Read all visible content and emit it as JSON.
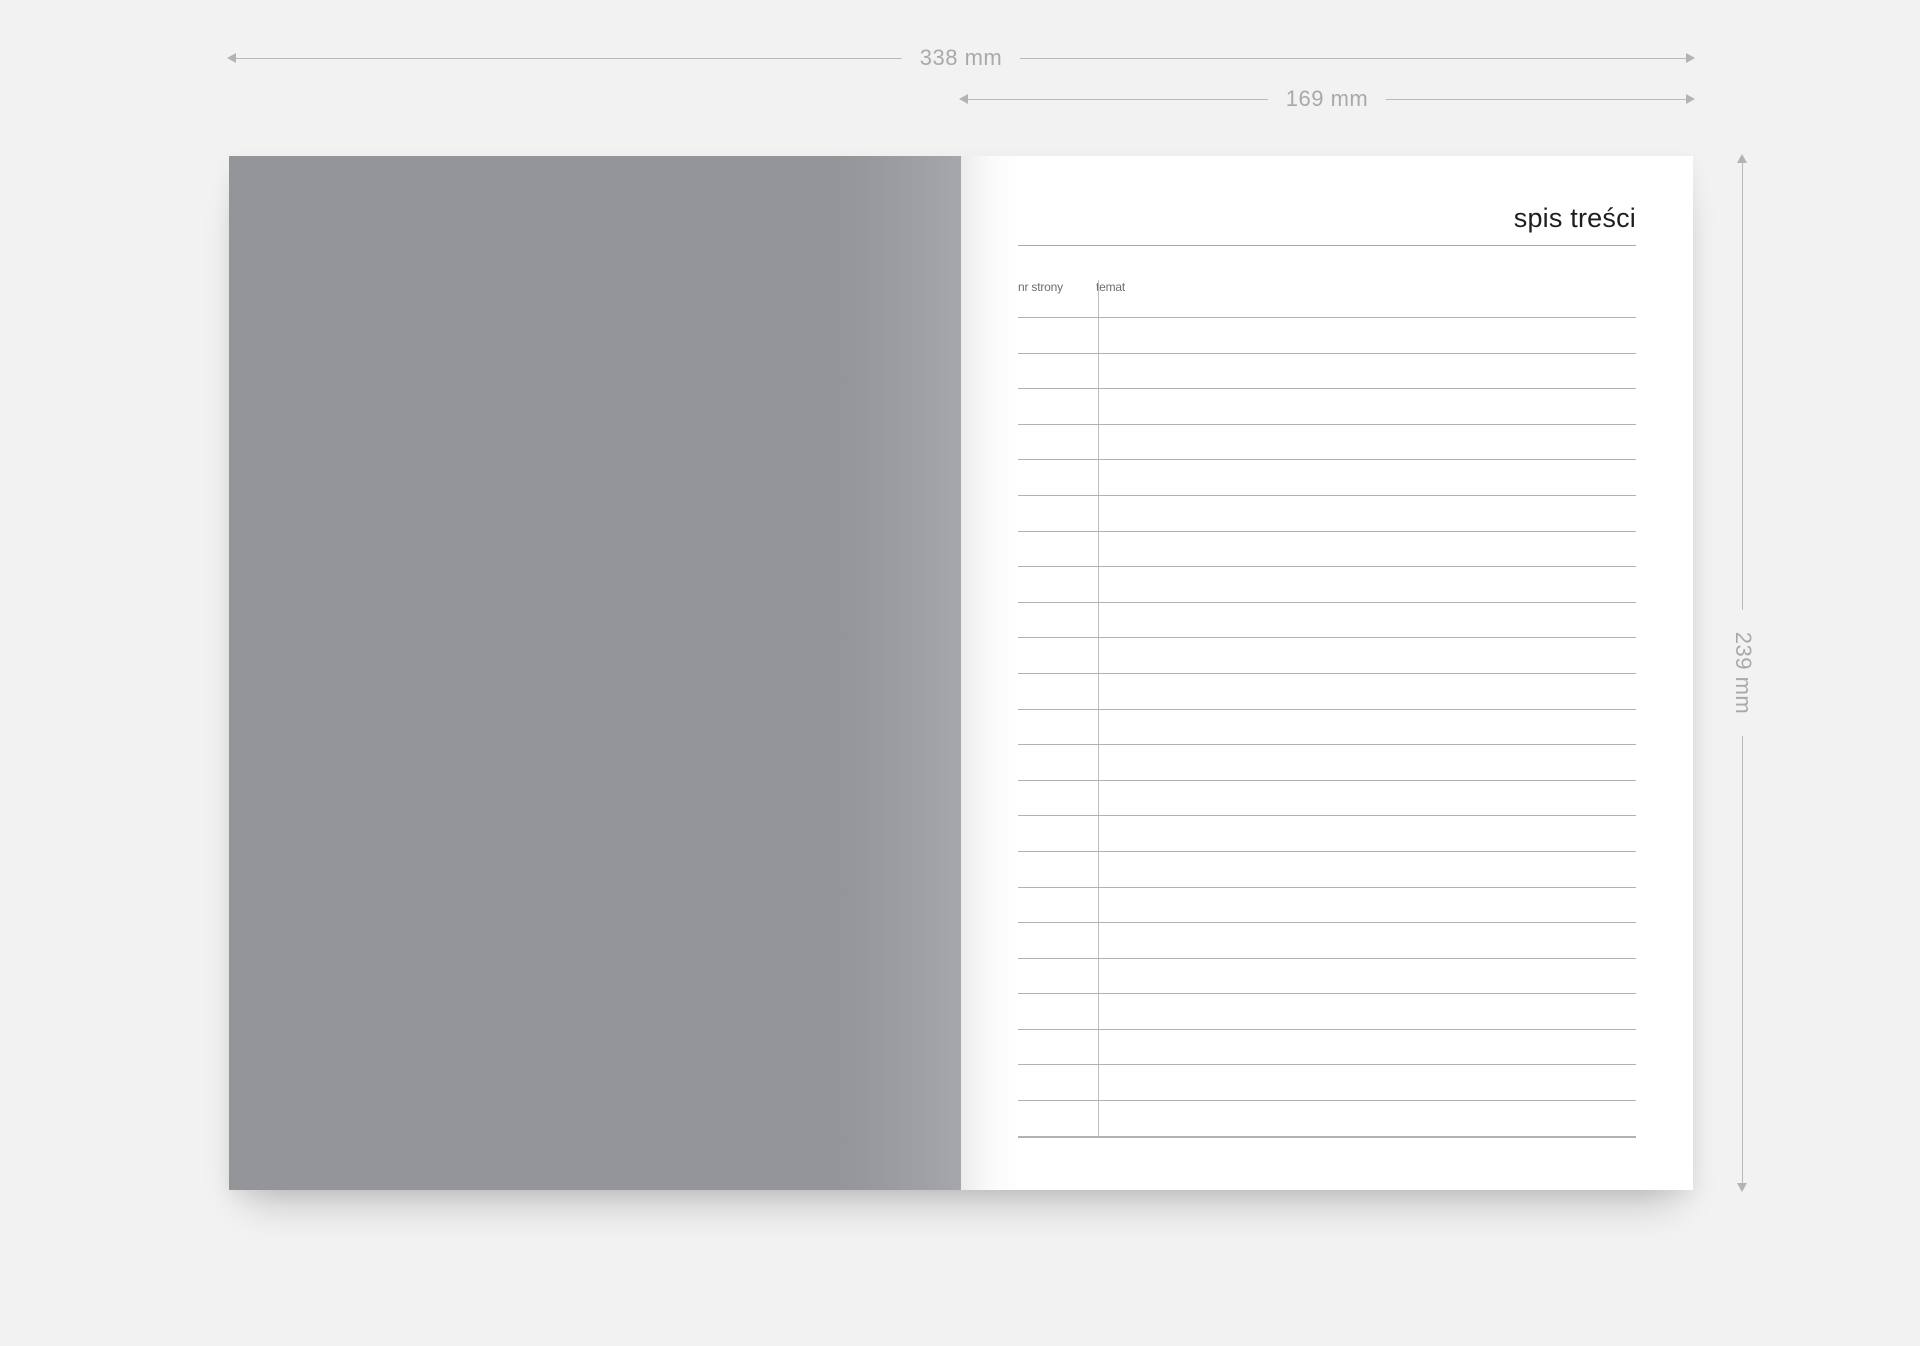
{
  "dimensions": {
    "total_width": "338 mm",
    "page_width": "169 mm",
    "height": "239 mm"
  },
  "page": {
    "title": "spis treści",
    "columns": [
      "nr strony",
      "temat"
    ],
    "row_count": 24
  },
  "colors": {
    "background": "#f2f2f2",
    "cover": "#949598",
    "page": "#ffffff",
    "rule": "#b2b2b2",
    "dimension": "#b3b3b3"
  }
}
